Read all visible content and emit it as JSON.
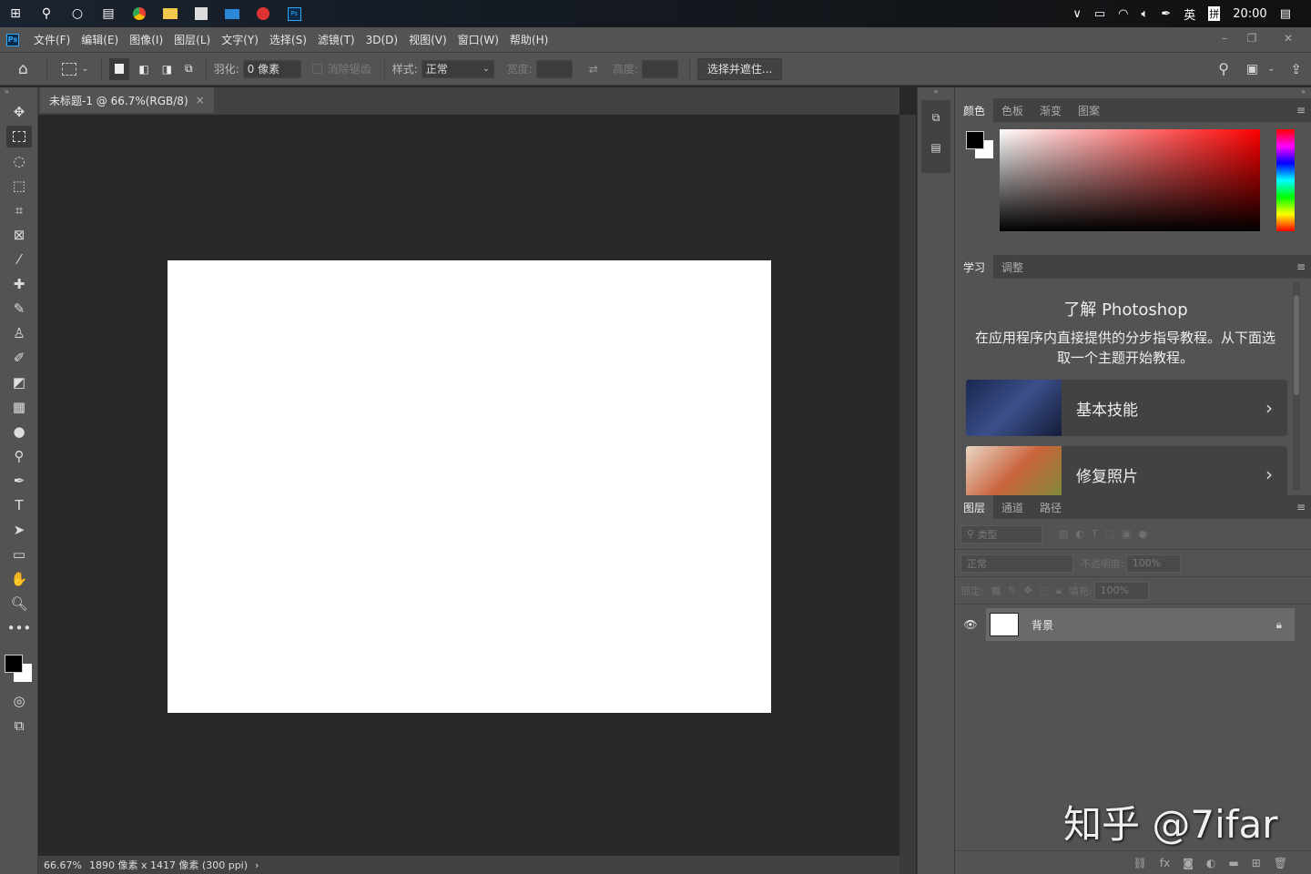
{
  "taskbar": {
    "time": "20:00",
    "ime_lang": "英",
    "ime_mode": "拼",
    "icons": [
      "windows-start-icon",
      "search-icon",
      "cortana-icon",
      "task-view-icon",
      "chrome-icon",
      "file-explorer-icon",
      "store-icon",
      "mail-icon",
      "netease-music-icon",
      "photoshop-icon"
    ]
  },
  "app": {
    "logo": "Ps",
    "accent": "#31a8ff"
  },
  "menu": [
    "文件(F)",
    "编辑(E)",
    "图像(I)",
    "图层(L)",
    "文字(Y)",
    "选择(S)",
    "滤镜(T)",
    "3D(D)",
    "视图(V)",
    "窗口(W)",
    "帮助(H)"
  ],
  "options": {
    "feather_label": "羽化:",
    "feather_value": "0 像素",
    "antialias_label": "消除锯齿",
    "style_label": "样式:",
    "style_value": "正常",
    "width_label": "宽度:",
    "height_label": "高度:",
    "select_mask_button": "选择并遮住..."
  },
  "document": {
    "tab_title": "未标题-1 @ 66.7%(RGB/8)",
    "close": "×",
    "canvas_color": "#ffffff"
  },
  "status": {
    "zoom": "66.67%",
    "info": "1890 像素 x 1417 像素 (300 ppi)",
    "arrow": "›"
  },
  "color_panel": {
    "tabs": [
      "颜色",
      "色板",
      "渐变",
      "图案"
    ],
    "hue": "#ff0000",
    "foreground": "#000000",
    "background": "#ffffff"
  },
  "learn_panel": {
    "tabs": [
      "学习",
      "调整"
    ],
    "title": "了解 Photoshop",
    "description": "在应用程序内直接提供的分步指导教程。从下面选取一个主题开始教程。",
    "cards": [
      {
        "label": "基本技能"
      },
      {
        "label": "修复照片"
      }
    ]
  },
  "layers_panel": {
    "tabs": [
      "图层",
      "通道",
      "路径"
    ],
    "filter_placeholder": "类型",
    "blend_mode": "正常",
    "opacity_label": "不透明度:",
    "opacity_value": "100%",
    "lock_label": "锁定:",
    "fill_label": "填充:",
    "fill_value": "100%",
    "layers": [
      {
        "name": "背景",
        "visible": true,
        "locked": true
      }
    ]
  },
  "watermark": "知乎 @7ifar"
}
